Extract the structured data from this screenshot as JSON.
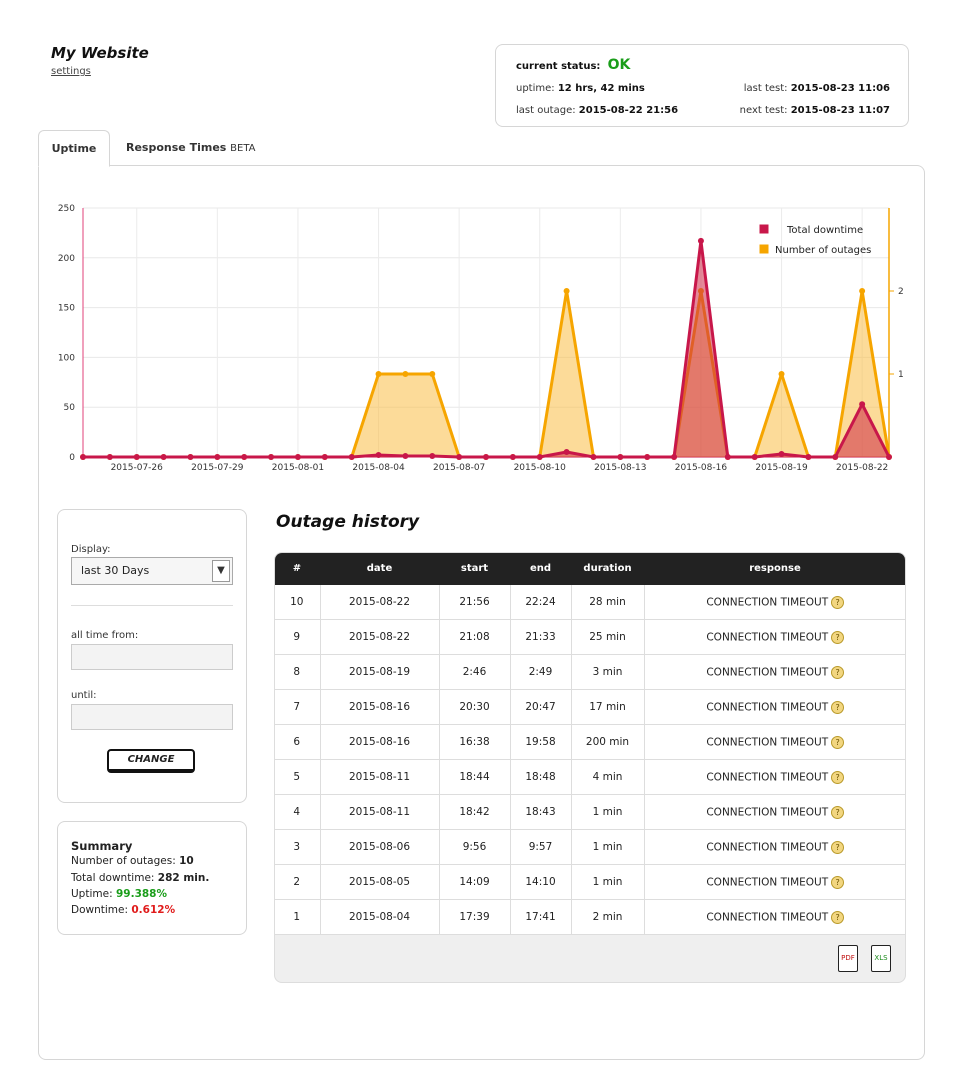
{
  "header": {
    "site_title": "My Website",
    "settings_link": "settings"
  },
  "status": {
    "current_status_label": "current status:",
    "current_status_value": "OK",
    "uptime_label": "uptime:",
    "uptime_value": "12 hrs, 42 mins",
    "last_outage_label": "last outage:",
    "last_outage_value": "2015-08-22 21:56",
    "last_test_label": "last test:",
    "last_test_value": "2015-08-23 11:06",
    "next_test_label": "next test:",
    "next_test_value": "2015-08-23 11:07",
    "ok_color": "#1a9d1a"
  },
  "tabs": [
    {
      "label": "Uptime",
      "active": true
    },
    {
      "label": "Response Times",
      "suffix": "BETA",
      "active": false
    }
  ],
  "chart_data": {
    "type": "area",
    "x": [
      "2015-07-24",
      "2015-07-25",
      "2015-07-26",
      "2015-07-27",
      "2015-07-28",
      "2015-07-29",
      "2015-07-30",
      "2015-07-31",
      "2015-08-01",
      "2015-08-02",
      "2015-08-03",
      "2015-08-04",
      "2015-08-05",
      "2015-08-06",
      "2015-08-07",
      "2015-08-08",
      "2015-08-09",
      "2015-08-10",
      "2015-08-11",
      "2015-08-12",
      "2015-08-13",
      "2015-08-14",
      "2015-08-15",
      "2015-08-16",
      "2015-08-17",
      "2015-08-18",
      "2015-08-19",
      "2015-08-20",
      "2015-08-21",
      "2015-08-22",
      "2015-08-23"
    ],
    "x_tick_labels": [
      "2015-07-26",
      "2015-07-29",
      "2015-08-01",
      "2015-08-04",
      "2015-08-07",
      "2015-08-10",
      "2015-08-13",
      "2015-08-16",
      "2015-08-19",
      "2015-08-22"
    ],
    "series": [
      {
        "name": "Total downtime",
        "axis": "left",
        "color": "#c8174a",
        "values": [
          0,
          0,
          0,
          0,
          0,
          0,
          0,
          0,
          0,
          0,
          0,
          2,
          1,
          1,
          0,
          0,
          0,
          0,
          5,
          0,
          0,
          0,
          0,
          217,
          0,
          0,
          3,
          0,
          0,
          53,
          0
        ]
      },
      {
        "name": "Number of outages",
        "axis": "right",
        "color": "#f6a500",
        "values": [
          0,
          0,
          0,
          0,
          0,
          0,
          0,
          0,
          0,
          0,
          0,
          1,
          1,
          1,
          0,
          0,
          0,
          0,
          2,
          0,
          0,
          0,
          0,
          2,
          0,
          0,
          1,
          0,
          0,
          2,
          0
        ]
      }
    ],
    "left_axis": {
      "ylim": [
        0,
        250
      ],
      "ticks": [
        0,
        50,
        100,
        150,
        200,
        250
      ]
    },
    "right_axis": {
      "ylim": [
        0,
        3
      ],
      "ticks": [
        1,
        2
      ]
    },
    "legend_position": "top-right",
    "grid": true
  },
  "filter": {
    "display_label": "Display:",
    "display_value": "last 30 Days",
    "from_label": "all time from:",
    "until_label": "until:",
    "change_button": "CHANGE"
  },
  "summary": {
    "title": "Summary",
    "outages_label": "Number of outages:",
    "outages_value": "10",
    "downtime_label": "Total downtime:",
    "downtime_value": "282 min.",
    "uptime_label": "Uptime:",
    "uptime_value": "99.388%",
    "downtime_pct_label": "Downtime:",
    "downtime_pct_value": "0.612%"
  },
  "outage_history": {
    "title": "Outage history",
    "columns": [
      "#",
      "date",
      "start",
      "end",
      "duration",
      "response"
    ],
    "rows": [
      [
        "10",
        "2015-08-22",
        "21:56",
        "22:24",
        "28 min",
        "CONNECTION TIMEOUT"
      ],
      [
        "9",
        "2015-08-22",
        "21:08",
        "21:33",
        "25 min",
        "CONNECTION TIMEOUT"
      ],
      [
        "8",
        "2015-08-19",
        "2:46",
        "2:49",
        "3 min",
        "CONNECTION TIMEOUT"
      ],
      [
        "7",
        "2015-08-16",
        "20:30",
        "20:47",
        "17 min",
        "CONNECTION TIMEOUT"
      ],
      [
        "6",
        "2015-08-16",
        "16:38",
        "19:58",
        "200 min",
        "CONNECTION TIMEOUT"
      ],
      [
        "5",
        "2015-08-11",
        "18:44",
        "18:48",
        "4 min",
        "CONNECTION TIMEOUT"
      ],
      [
        "4",
        "2015-08-11",
        "18:42",
        "18:43",
        "1 min",
        "CONNECTION TIMEOUT"
      ],
      [
        "3",
        "2015-08-06",
        "9:56",
        "9:57",
        "1 min",
        "CONNECTION TIMEOUT"
      ],
      [
        "2",
        "2015-08-05",
        "14:09",
        "14:10",
        "1 min",
        "CONNECTION TIMEOUT"
      ],
      [
        "1",
        "2015-08-04",
        "17:39",
        "17:41",
        "2 min",
        "CONNECTION TIMEOUT"
      ]
    ],
    "help_icon": "question-mark-icon",
    "export": {
      "pdf_label": "PDF",
      "xls_label": "XLS"
    }
  }
}
